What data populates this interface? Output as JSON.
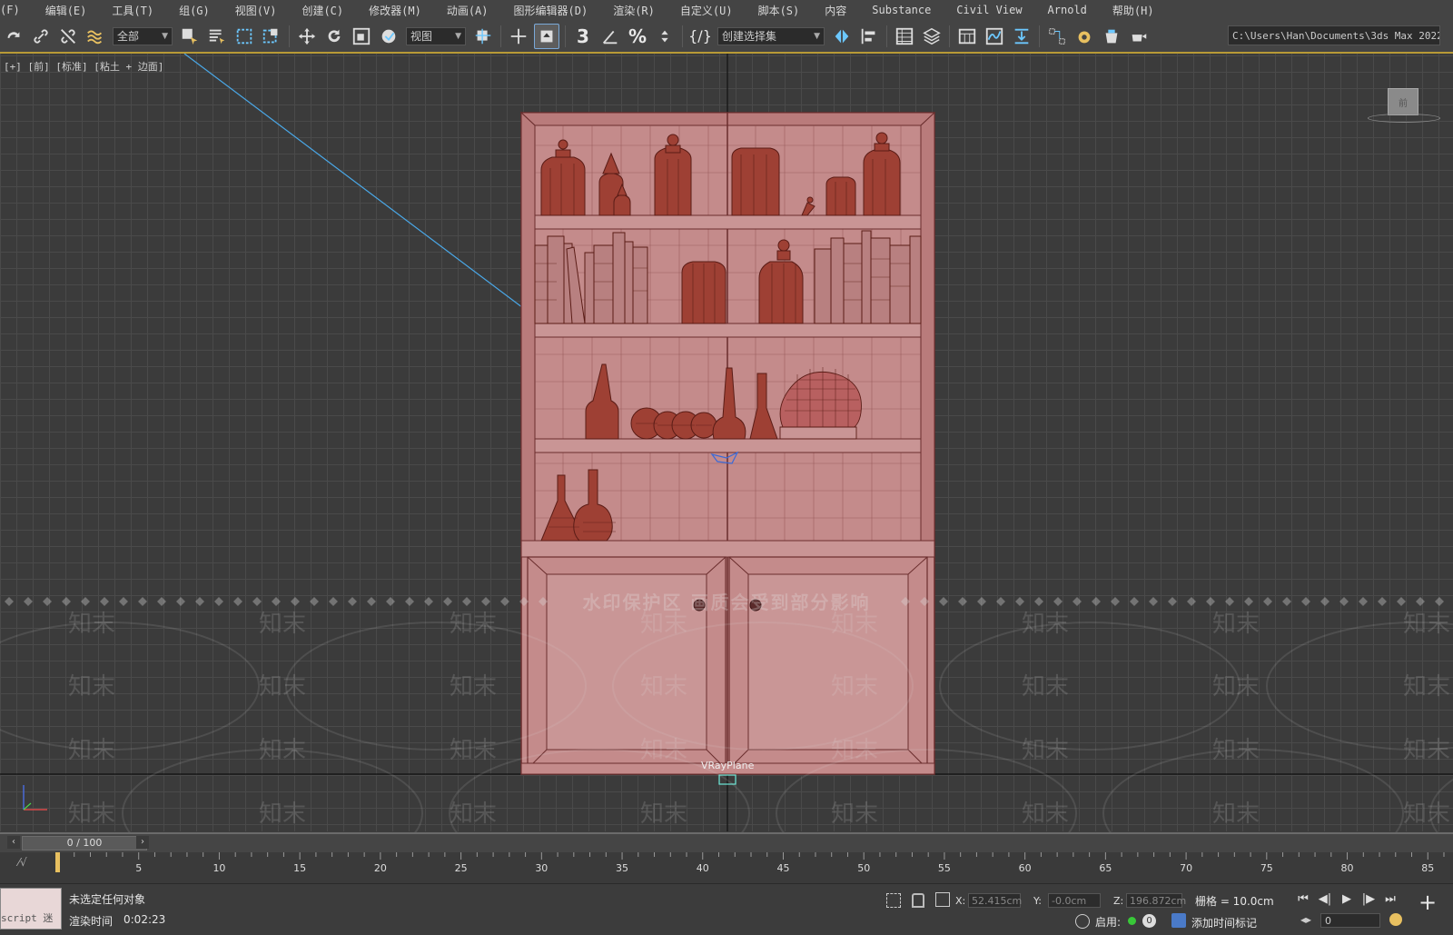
{
  "menu": [
    "(F)",
    "编辑(E)",
    "工具(T)",
    "组(G)",
    "视图(V)",
    "创建(C)",
    "修改器(M)",
    "动画(A)",
    "图形编辑器(D)",
    "渲染(R)",
    "自定义(U)",
    "脚本(S)",
    "内容",
    "Substance",
    "Civil View",
    "Arnold",
    "帮助(H)"
  ],
  "toolbar": {
    "selection_filter": "全部",
    "ref_coord": "视图",
    "named_selection": "创建选择集",
    "project_path": "C:\\Users\\Han\\Documents\\3ds Max 2022"
  },
  "viewport": {
    "label": "[+] [前] [标准] [粘土 + 边面]",
    "navcube_label": "前",
    "object_label": "VRayPlane",
    "watermark_notice": "水印保护区  画质会受到部分影响",
    "watermark_logo": "知末"
  },
  "timeline": {
    "frame_display": "0 / 100",
    "ticks": [
      "5",
      "10",
      "15",
      "20",
      "25",
      "30",
      "35",
      "40",
      "45",
      "50",
      "55",
      "60",
      "65",
      "70",
      "75",
      "80",
      "85"
    ]
  },
  "status": {
    "maxscript_label": "script 迷",
    "message": "未选定任何对象",
    "render_time_label": "渲染时间",
    "render_time_value": "0:02:23",
    "x_label": "X:",
    "x_value": "52.415cm",
    "y_label": "Y:",
    "y_value": "-0.0cm",
    "z_label": "Z:",
    "z_value": "196.872cm",
    "grid": "栅格 = 10.0cm",
    "enable_label": "启用:",
    "enable_count": "0",
    "add_time_tag": "添加时间标记",
    "frame_value": "0"
  },
  "colors": {
    "object_fill": "#c48a8a",
    "object_wire": "#6a2d2d",
    "jar_fill": "#9e4034",
    "ui_bg": "#444444",
    "viewport_bg": "#3b3b3b",
    "active_border": "#b89a36"
  }
}
